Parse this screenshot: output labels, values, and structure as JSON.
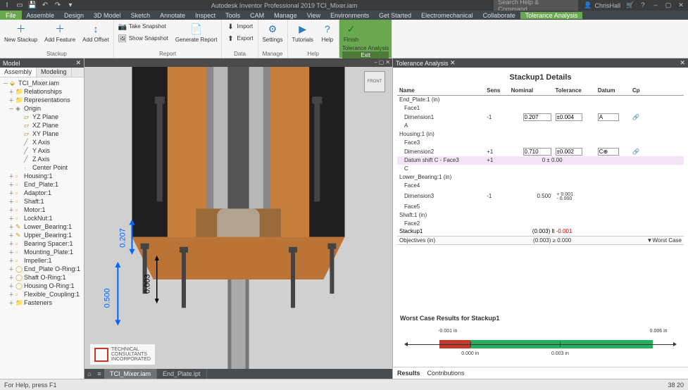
{
  "titlebar": {
    "title": "Autodesk Inventor Professional 2019   TCI_Mixer.iam",
    "search_placeholder": "Search Help & Command…",
    "user": "ChrisHall"
  },
  "menubar": {
    "file": "File",
    "items": [
      "Assemble",
      "Design",
      "3D Model",
      "Sketch",
      "Annotate",
      "Inspect",
      "Tools",
      "CAM",
      "Manage",
      "View",
      "Environments",
      "Get Started",
      "Electromechanical",
      "Collaborate",
      "Tolerance Analysis"
    ],
    "active": 14
  },
  "ribbon": {
    "groups": [
      {
        "label": "Stackup",
        "buttons": [
          {
            "t": "New Stackup",
            "i": "＋"
          },
          {
            "t": "Add Feature",
            "i": "＋"
          },
          {
            "t": "Add Offset",
            "i": "↕"
          }
        ]
      },
      {
        "label": "Report",
        "buttons": [
          {
            "t": "Take Snapshot",
            "i": "📷",
            "small": true
          },
          {
            "t": "Show Snapshot",
            "i": "🖼",
            "small": true
          },
          {
            "t": "Generate Report",
            "i": "📄"
          }
        ]
      },
      {
        "label": "Data",
        "buttons": [
          {
            "t": "Import",
            "i": "⬇",
            "small": true
          },
          {
            "t": "Export",
            "i": "⬆",
            "small": true
          }
        ]
      },
      {
        "label": "Manage",
        "buttons": [
          {
            "t": "Settings",
            "i": "⚙"
          }
        ]
      },
      {
        "label": "Help",
        "buttons": [
          {
            "t": "Tutorials",
            "i": "▶"
          },
          {
            "t": "Help",
            "i": "?"
          }
        ]
      },
      {
        "label": "Exit",
        "sublabel": "Tolerance Analysis",
        "buttons": [
          {
            "t": "Finish",
            "i": "✓"
          }
        ],
        "exit": true
      }
    ]
  },
  "model_panel": {
    "title": "Model",
    "tabs": [
      "Assembly",
      "Modeling"
    ],
    "active_tab": 0,
    "root": "TCI_Mixer.iam",
    "level1": [
      {
        "exp": "＋",
        "ico": "📁",
        "cls": "folder",
        "t": "Relationships"
      },
      {
        "exp": "＋",
        "ico": "📁",
        "cls": "folder",
        "t": "Representations"
      },
      {
        "exp": "－",
        "ico": "◈",
        "cls": "origin",
        "t": "Origin"
      }
    ],
    "origin_children": [
      {
        "ico": "▱",
        "cls": "plane",
        "t": "YZ Plane"
      },
      {
        "ico": "▱",
        "cls": "plane",
        "t": "XZ Plane"
      },
      {
        "ico": "▱",
        "cls": "plane",
        "t": "XY Plane"
      },
      {
        "ico": "╱",
        "cls": "axis",
        "t": "X Axis"
      },
      {
        "ico": "╱",
        "cls": "axis",
        "t": "Y Axis"
      },
      {
        "ico": "╱",
        "cls": "axis",
        "t": "Z Axis"
      },
      {
        "ico": "·",
        "cls": "axis",
        "t": "Center Point"
      }
    ],
    "parts": [
      {
        "t": "Housing:1"
      },
      {
        "t": "End_Plate:1"
      },
      {
        "t": "Adaptor:1"
      },
      {
        "t": "Shaft:1"
      },
      {
        "t": "Motor:1"
      },
      {
        "t": "LockNut:1"
      },
      {
        "t": "Lower_Bearing:1",
        "ico": "✎"
      },
      {
        "t": "Upper_Bearing:1",
        "ico": "✎"
      },
      {
        "t": "Bearing Spacer:1"
      },
      {
        "t": "Mounting_Plate:1"
      },
      {
        "t": "Impeller:1"
      },
      {
        "t": "End_Plate O-Ring:1",
        "ico": "◯"
      },
      {
        "t": "Shaft O-Ring:1",
        "ico": "◯"
      },
      {
        "t": "Housing O-Ring:1",
        "ico": "◯"
      },
      {
        "t": "Flexible_Coupling:1"
      },
      {
        "t": "Fasteners",
        "ico": "📁",
        "cls": "folder"
      }
    ]
  },
  "viewport": {
    "doctabs": [
      "TCI_Mixer.iam",
      "End_Plate.ipt"
    ],
    "active_doctab": 0,
    "viewcube": "FRONT",
    "dims": {
      "d1": "0.500",
      "d2": "0.207",
      "d3": "0.003"
    },
    "logo_lines": [
      "TECHNICAL",
      "CONSULTANTS",
      "INCORPORATED"
    ]
  },
  "analysis": {
    "tab_title": "Tolerance Analysis",
    "details_title": "Stackup1 Details",
    "headers": [
      "Name",
      "Sens",
      "Nominal",
      "Tolerance",
      "Datum",
      "Cp"
    ],
    "rows": [
      {
        "type": "group",
        "name": "End_Plate:1 (in)"
      },
      {
        "type": "sub",
        "name": "Face1"
      },
      {
        "type": "dim",
        "name": "Dimension1",
        "sens": "-1",
        "nominal": "0.207",
        "tol": "±0.004",
        "datum": "A",
        "link": true
      },
      {
        "type": "sub",
        "name": "A"
      },
      {
        "type": "group",
        "name": "Housing:1 (in)"
      },
      {
        "type": "sub",
        "name": "Face3"
      },
      {
        "type": "dim",
        "name": "Dimension2",
        "sens": "+1",
        "nominal": "0.710",
        "tol": "±0.002",
        "datum": "C⊕",
        "link": true
      },
      {
        "type": "hl",
        "name": "Datum shift C - Face3",
        "sens": "+1",
        "nominal": "0 ± 0.00"
      },
      {
        "type": "sub",
        "name": "C"
      },
      {
        "type": "group",
        "name": "Lower_Bearing:1 (in)"
      },
      {
        "type": "sub",
        "name": "Face4"
      },
      {
        "type": "dim2",
        "name": "Dimension3",
        "sens": "-1",
        "nominal": "0.500",
        "tolp": "+ 0.001",
        "tolm": "- 0.000"
      },
      {
        "type": "sub",
        "name": "Face5"
      },
      {
        "type": "group",
        "name": "Shaft:1 (in)"
      },
      {
        "type": "sub",
        "name": "Face2"
      },
      {
        "type": "stackup",
        "name": "Stackup1",
        "val": "(0.003) lt",
        "neg": "-0.001"
      },
      {
        "type": "obj",
        "name": "Objectives (in)",
        "val": "(0.003) ≥ 0.000",
        "method": "▼Worst Case"
      }
    ],
    "chart": {
      "title": "Worst Case Results for Stackup1",
      "min_label": "-0.001 in",
      "max_label": "0.006 in",
      "tick1": "0.000 in",
      "tick2": "0.003 in"
    },
    "result_tabs": [
      "Results",
      "Contributions"
    ],
    "active_result_tab": 0
  },
  "statusbar": {
    "left": "For Help, press F1",
    "right": "38  20"
  },
  "chart_data": {
    "type": "bar",
    "title": "Worst Case Results for Stackup1",
    "xlabel": "in",
    "xlim": [
      -0.0015,
      0.0065
    ],
    "segments": [
      {
        "name": "below-zero",
        "from": -0.001,
        "to": 0.0,
        "color": "#c0392b"
      },
      {
        "name": "above-zero",
        "from": 0.0,
        "to": 0.006,
        "color": "#27ae60"
      }
    ],
    "ticks": [
      0.0,
      0.003
    ],
    "endpoints": {
      "min": -0.001,
      "max": 0.006,
      "nominal": 0.003
    }
  }
}
